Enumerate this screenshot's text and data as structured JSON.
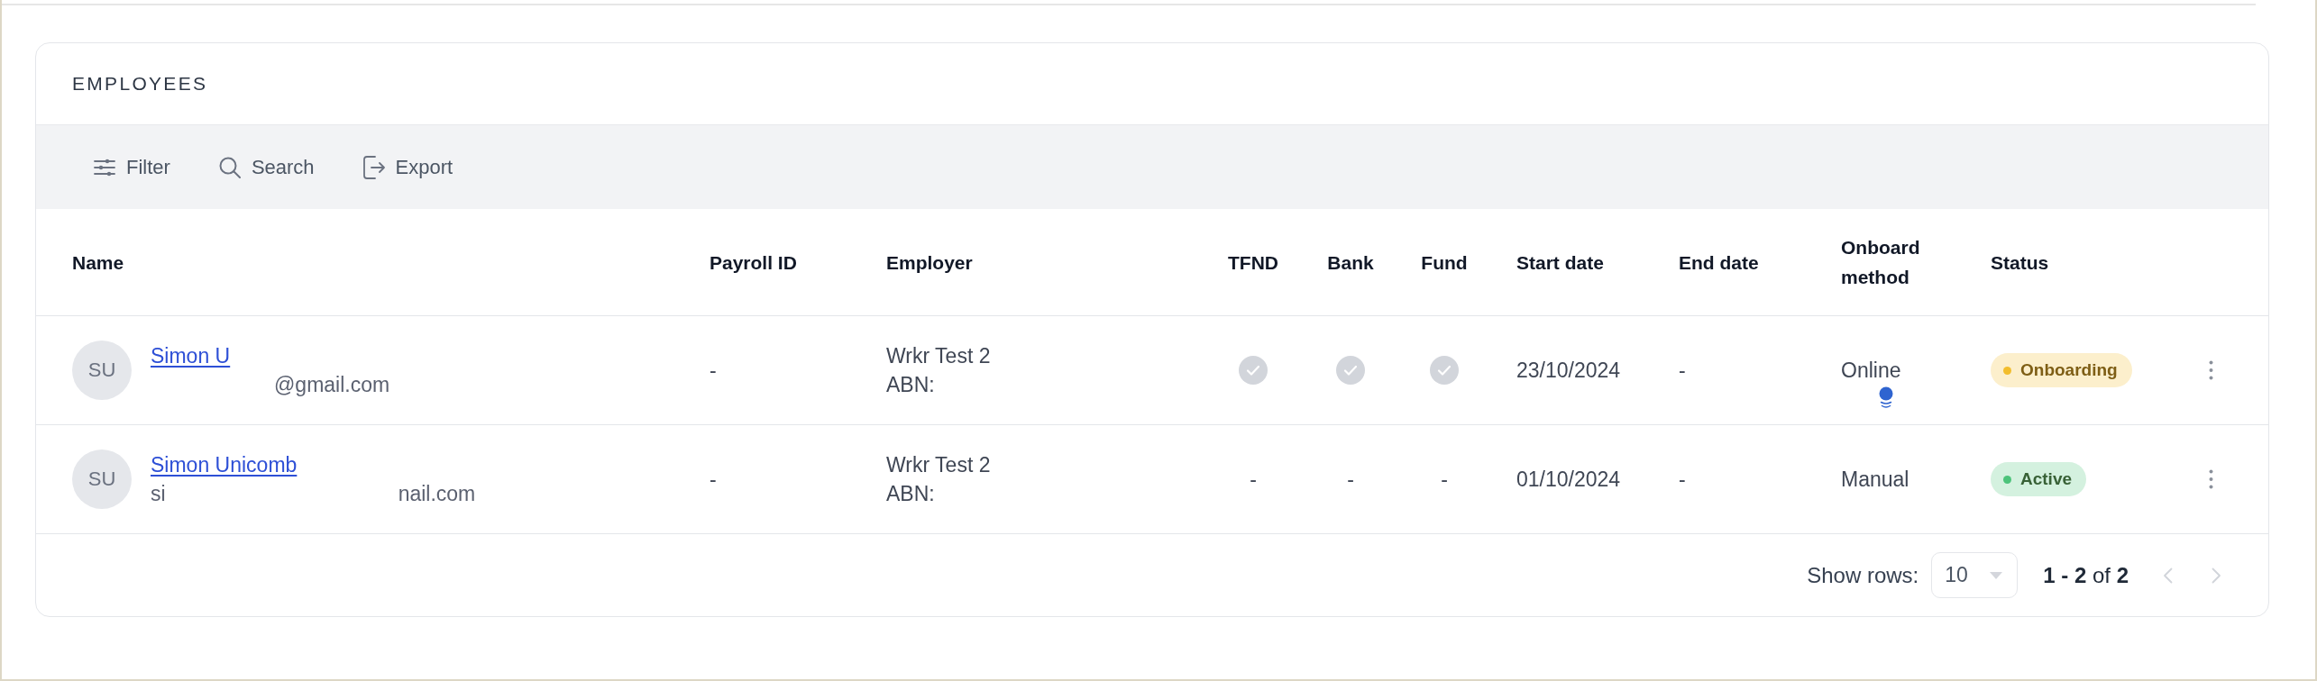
{
  "card": {
    "title": "EMPLOYEES"
  },
  "toolbar": [
    {
      "kind": "filter",
      "label": "Filter"
    },
    {
      "kind": "search",
      "label": "Search"
    },
    {
      "kind": "export",
      "label": "Export"
    }
  ],
  "table": {
    "columns": [
      "Name",
      "Payroll ID",
      "Employer",
      "TFND",
      "Bank",
      "Fund",
      "Start date",
      "End date",
      "Onboard method",
      "Status"
    ],
    "rows": [
      {
        "initials": "SU",
        "name": "Simon U",
        "email": [
          {
            "kind": "redacted"
          },
          {
            "kind": "text",
            "text": "@gmail.com"
          }
        ],
        "payroll_id": "-",
        "employer": "Wrkr Test 2",
        "abn": "ABN:",
        "tfnd": {
          "kind": "check"
        },
        "bank": {
          "kind": "check"
        },
        "fund": {
          "kind": "check"
        },
        "start_date": "23/10/2024",
        "end_date": "-",
        "onboard_method": {
          "text": "Online",
          "indicator": true
        },
        "status": {
          "label": "Onboarding",
          "color": "#f2bd2c"
        }
      },
      {
        "initials": "SU",
        "name": "Simon Unicomb",
        "email": [
          {
            "kind": "text",
            "text": "si"
          },
          {
            "kind": "redacted"
          },
          {
            "kind": "text",
            "text": "nail.com"
          }
        ],
        "payroll_id": "-",
        "employer": "Wrkr Test 2",
        "abn": "ABN:",
        "tfnd": {
          "kind": "text",
          "text": "-"
        },
        "bank": {
          "kind": "text",
          "text": "-"
        },
        "fund": {
          "kind": "text",
          "text": "-"
        },
        "start_date": "01/10/2024",
        "end_date": "-",
        "onboard_method": {
          "text": "Manual",
          "indicator": false
        },
        "status": {
          "label": "Active",
          "color": "#4cc37a"
        }
      }
    ]
  },
  "footer": {
    "rows_label": "Show rows:",
    "rows_per_page": "10",
    "range": "**1 - 2** of **2**",
    "prev_disabled": true,
    "next_disabled": true
  }
}
